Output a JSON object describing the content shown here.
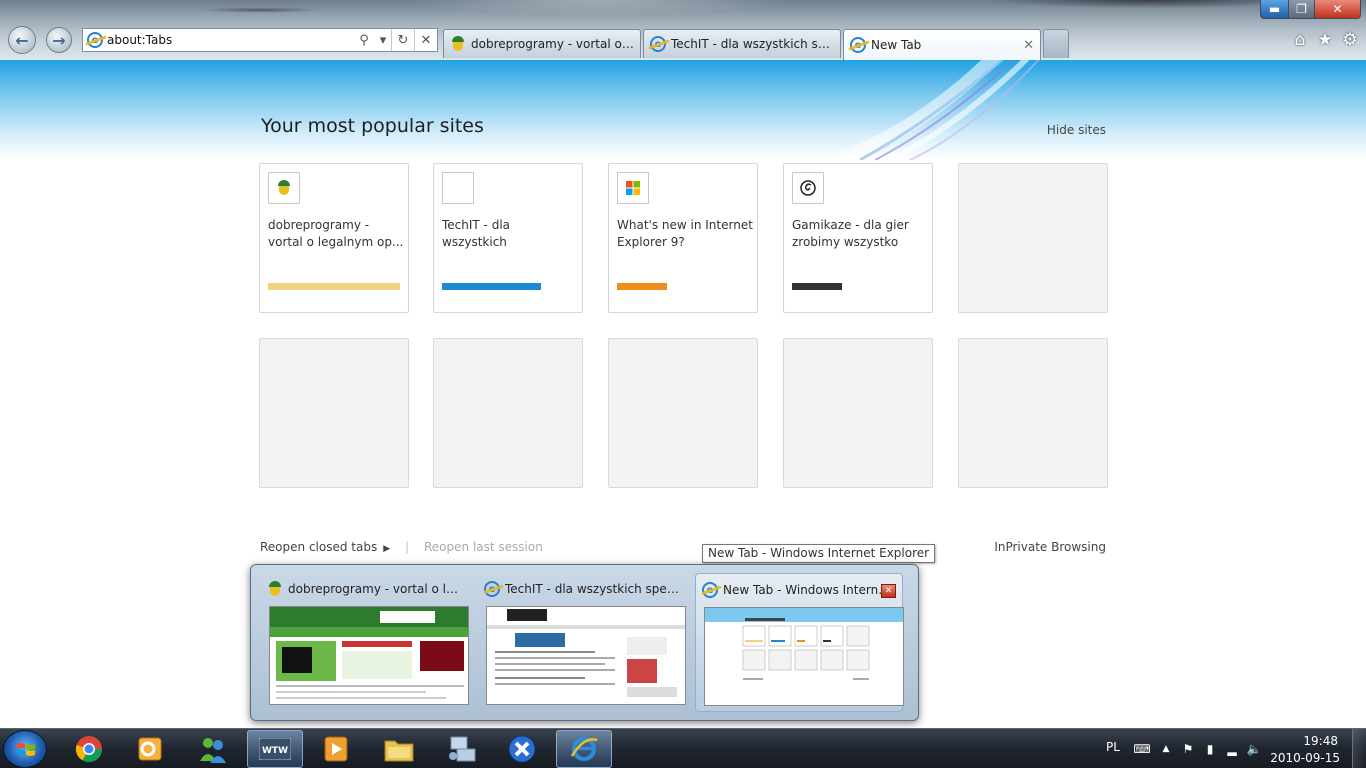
{
  "browser": {
    "address": "about:Tabs",
    "tabs": [
      {
        "label": "dobreprogramy - vortal o lega...",
        "icon": "dobreprogramy-favicon"
      },
      {
        "label": "TechIT - dla wszystkich specja...",
        "icon": "ie-icon"
      },
      {
        "label": "New Tab",
        "icon": "ie-icon",
        "close": "✕"
      }
    ]
  },
  "page": {
    "title": "Your most popular sites",
    "hide_sites": "Hide sites",
    "tiles": [
      {
        "title": "dobreprogramy - vortal o legalnym op...",
        "bar_color": "#f2d27e",
        "bar_fraction": 1.0,
        "icon": "dobreprogramy-favicon"
      },
      {
        "title": "TechIT - dla wszystkich specjalistów IT",
        "bar_color": "#1a8ad4",
        "bar_fraction": 0.75,
        "icon": "blank-favicon"
      },
      {
        "title": "What's new in Internet Explorer 9?",
        "bar_color": "#f08c1c",
        "bar_fraction": 0.38,
        "icon": "windows-favicon"
      },
      {
        "title": "Gamikaze - dla gier zrobimy wszystko",
        "bar_color": "#333333",
        "bar_fraction": 0.38,
        "icon": "gamikaze-favicon"
      }
    ],
    "reopen_closed_tabs": "Reopen closed tabs",
    "separator": "|",
    "reopen_last_session": "Reopen last session",
    "inprivate": "InPrivate Browsing"
  },
  "preview": {
    "tooltip": "New Tab - Windows Internet Explorer",
    "thumbnails": [
      {
        "label": "dobreprogramy - vortal o legaln...",
        "icon": "dobreprogramy-favicon"
      },
      {
        "label": "TechIT - dla wszystkich specjalis...",
        "icon": "ie-icon"
      },
      {
        "label": "New Tab - Windows Interne...",
        "icon": "ie-icon"
      }
    ]
  },
  "taskbar": {
    "apps": [
      "chrome-icon",
      "outlook-icon",
      "messenger-icon",
      "wtw-icon",
      "media-player-icon",
      "explorer-icon",
      "network-icon",
      "xnview-icon",
      "internet-explorer-icon"
    ],
    "language": "PL",
    "time": "19:48",
    "date": "2010-09-15"
  }
}
